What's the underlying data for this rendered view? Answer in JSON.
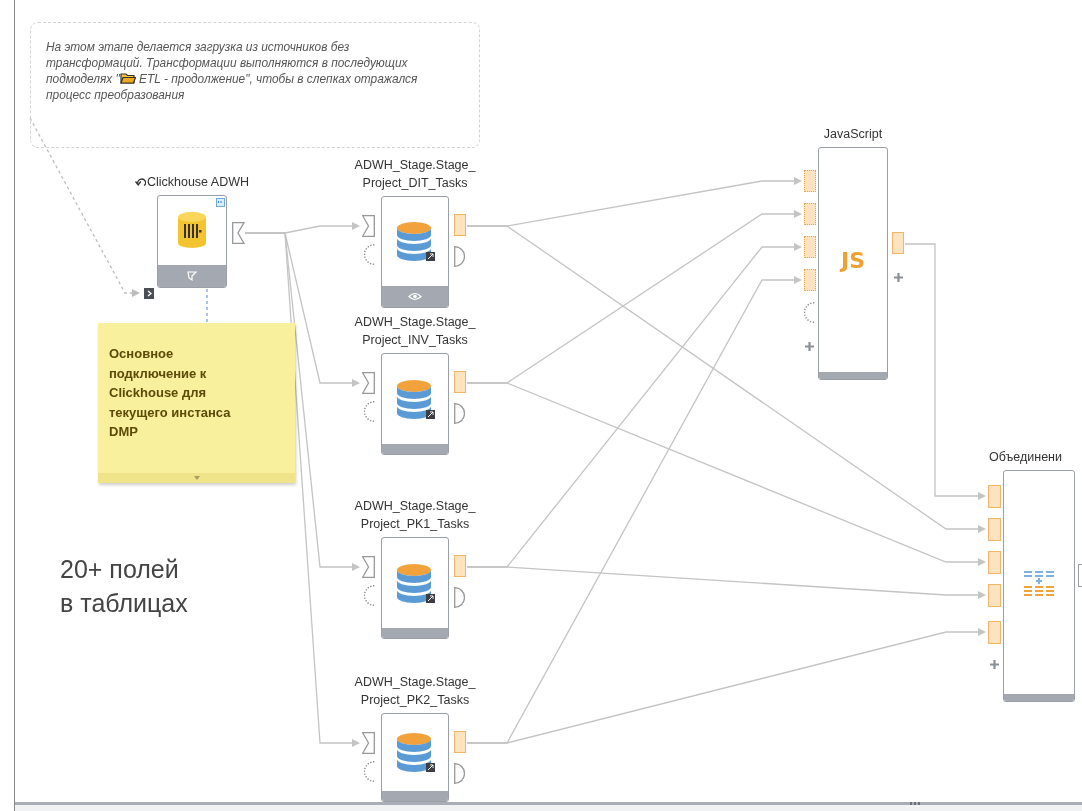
{
  "comment": {
    "parts": [
      "На этом этапе делается загрузка из источников без трансформаций. Трансформации выполняются в последующих подмоделях \"",
      "ETL - продолжение\", чтобы в слепках отражался процесс преобразования"
    ]
  },
  "sticky_note": {
    "text": "Основное подключение к Clickhouse для текущего инстанса DMP"
  },
  "annotation": {
    "text": "20+ полей\nв таблицах"
  },
  "nodes": [
    {
      "kind": "source",
      "label": "Clickhouse ADWH"
    },
    {
      "kind": "table",
      "label": "ADWH_Stage.Stage_\nProject_DIT_Tasks",
      "preview": true
    },
    {
      "kind": "table",
      "label": "ADWH_Stage.Stage_\nProject_INV_Tasks",
      "preview": false
    },
    {
      "kind": "table",
      "label": "ADWH_Stage.Stage_\nProject_PK1_Tasks",
      "preview": false
    },
    {
      "kind": "table",
      "label": "ADWH_Stage.Stage_\nProject_PK2_Tasks",
      "preview": false
    },
    {
      "kind": "script",
      "label": "JavaScript",
      "badge": "JS"
    },
    {
      "kind": "union",
      "label": "Объединени"
    }
  ]
}
